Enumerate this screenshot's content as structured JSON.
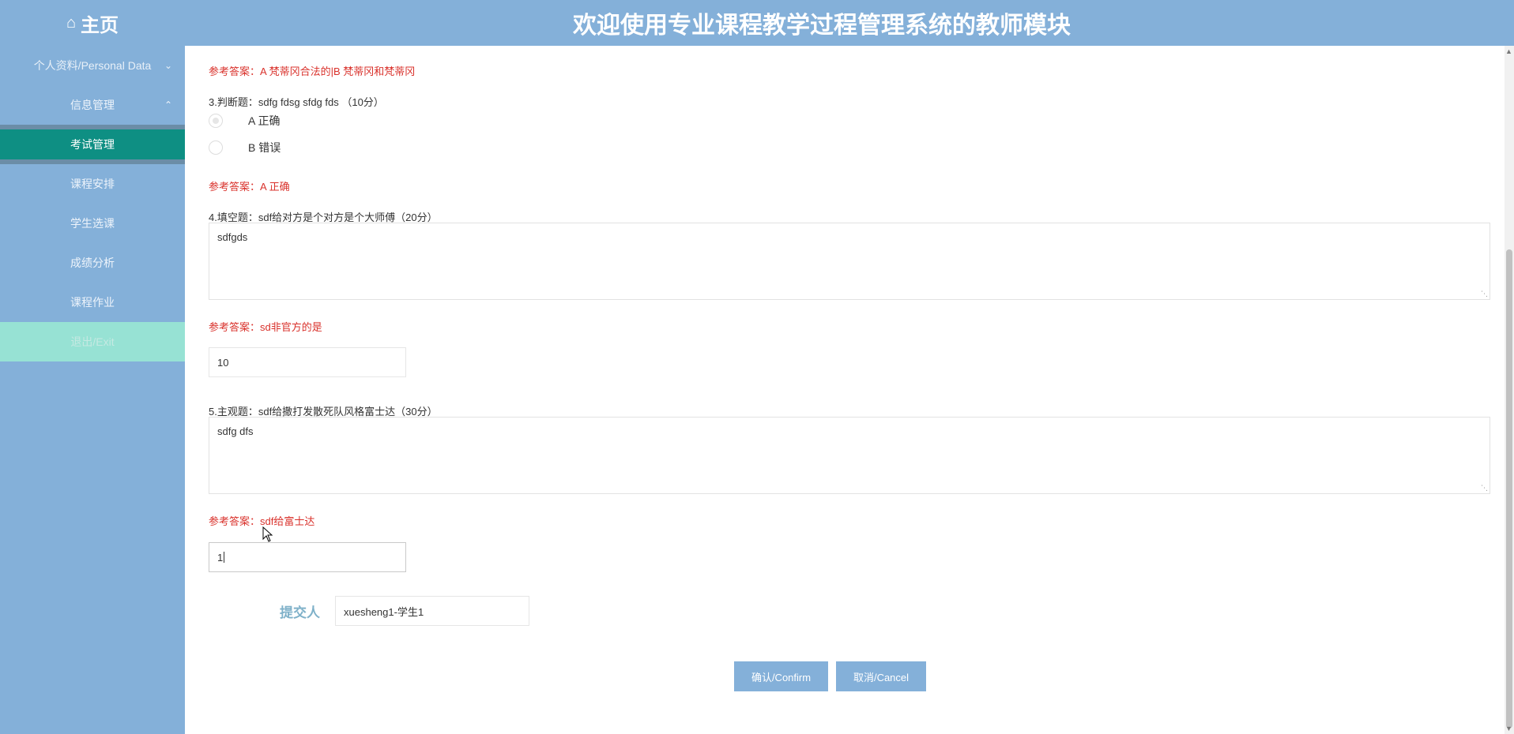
{
  "header": {
    "home_label": "主页",
    "title": "欢迎使用专业课程教学过程管理系统的教师模块"
  },
  "sidebar": {
    "items": [
      {
        "label": "个人资料/Personal Data"
      },
      {
        "label": "信息管理"
      },
      {
        "label": "考试管理"
      },
      {
        "label": "课程安排"
      },
      {
        "label": "学生选课"
      },
      {
        "label": "成绩分析"
      },
      {
        "label": "课程作业"
      },
      {
        "label": "退出/Exit"
      }
    ]
  },
  "main": {
    "ref_top": "参考答案：A 梵蒂冈合法的|B 梵蒂冈和梵蒂冈",
    "q3": {
      "title": "3.判断题：sdfg fdsg sfdg fds （10分）",
      "option_a": "A 正确",
      "option_b": "B 错误",
      "ref": "参考答案：A 正确"
    },
    "q4": {
      "title": "4.填空题：sdf给对方是个对方是个大师傅（20分）",
      "answer": "sdfgds",
      "ref": "参考答案：sd非官方的是",
      "score": "10"
    },
    "q5": {
      "title": "5.主观题：sdf给撒打发散死队风格富士达（30分）",
      "answer": "sdfg dfs",
      "ref": "参考答案：sdf给富士达",
      "score": "1"
    },
    "submitter": {
      "label": "提交人",
      "value": "xuesheng1-学生1"
    },
    "buttons": {
      "confirm": "确认/Confirm",
      "cancel": "取消/Cancel"
    }
  },
  "icons": {
    "home": "home-icon",
    "chevron_down": "chevron-down-icon",
    "chevron_up": "chevron-up-icon"
  },
  "colors": {
    "header_bg": "#84b0d9",
    "active_nav": "#0e8f83",
    "exit_nav": "#97e2d4",
    "reference_text": "#d9312b",
    "submitter_label": "#7fb1c9"
  }
}
